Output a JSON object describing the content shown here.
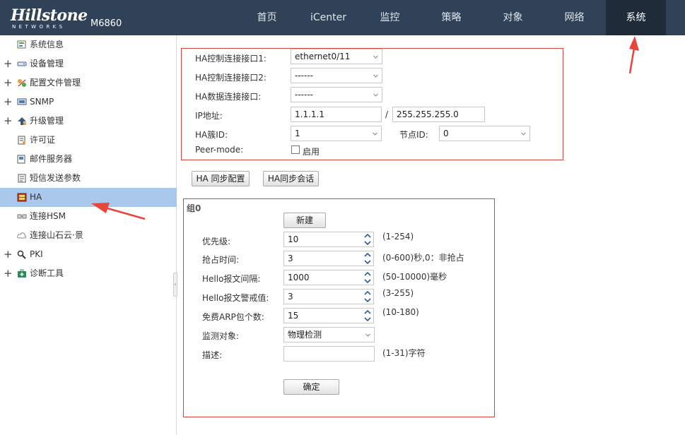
{
  "header": {
    "brand": "Hillstone",
    "brand_sub": "NETWORKS",
    "model": "M6860",
    "nav": [
      {
        "label": "首页",
        "name": "nav-home"
      },
      {
        "label": "iCenter",
        "name": "nav-icenter"
      },
      {
        "label": "监控",
        "name": "nav-monitor"
      },
      {
        "label": "策略",
        "name": "nav-policy"
      },
      {
        "label": "对象",
        "name": "nav-object"
      },
      {
        "label": "网络",
        "name": "nav-network"
      },
      {
        "label": "系统",
        "name": "nav-system"
      }
    ],
    "active_nav": "系统"
  },
  "sidebar": {
    "items": [
      {
        "label": "系统信息",
        "expandable": false,
        "icon": "system-info-icon"
      },
      {
        "label": "设备管理",
        "expandable": true,
        "icon": "device-icon"
      },
      {
        "label": "配置文件管理",
        "expandable": true,
        "icon": "config-file-icon"
      },
      {
        "label": "SNMP",
        "expandable": true,
        "icon": "snmp-icon"
      },
      {
        "label": "升级管理",
        "expandable": true,
        "icon": "upgrade-icon"
      },
      {
        "label": "许可证",
        "expandable": false,
        "icon": "license-icon"
      },
      {
        "label": "邮件服务器",
        "expandable": false,
        "icon": "mail-icon"
      },
      {
        "label": "短信发送参数",
        "expandable": false,
        "icon": "sms-icon"
      },
      {
        "label": "HA",
        "expandable": false,
        "icon": "ha-icon",
        "active": true
      },
      {
        "label": "连接HSM",
        "expandable": false,
        "icon": "hsm-icon"
      },
      {
        "label": "连接山石云·景",
        "expandable": false,
        "icon": "cloud-icon"
      },
      {
        "label": "PKI",
        "expandable": true,
        "icon": "pki-icon"
      },
      {
        "label": "诊断工具",
        "expandable": true,
        "icon": "diagnostic-icon"
      }
    ]
  },
  "ha_link": {
    "ctrl_if1_label": "HA控制连接接口1:",
    "ctrl_if1_value": "ethernet0/11",
    "ctrl_if2_label": "HA控制连接接口2:",
    "ctrl_if2_value": "------",
    "data_if_label": "HA数据连接接口:",
    "data_if_value": "------",
    "ip_label": "IP地址:",
    "ip_value": "1.1.1.1",
    "ip_sep": "/",
    "mask_value": "255.255.255.0",
    "cluster_label": "HA簇ID:",
    "cluster_value": "1",
    "node_label": "节点ID:",
    "node_value": "0",
    "peer_label": "Peer-mode:",
    "peer_check_label": "启用"
  },
  "sync": {
    "config_button": "HA 同步配置",
    "session_button": "HA同步会话"
  },
  "group": {
    "title": "组0",
    "new_button": "新建",
    "priority_label": "优先级:",
    "priority_value": "10",
    "priority_hint": "(1-254)",
    "preempt_label": "抢占时间:",
    "preempt_value": "3",
    "preempt_hint": "(0-600)秒,0：非抢占",
    "hello_int_label": "Hello报文间隔:",
    "hello_int_value": "1000",
    "hello_int_hint": "(50-10000)毫秒",
    "hello_thr_label": "Hello报文警戒值:",
    "hello_thr_value": "3",
    "hello_thr_hint": "(3-255)",
    "arp_label": "免费ARP包个数:",
    "arp_value": "15",
    "arp_hint": "(10-180)",
    "monitor_label": "监测对象:",
    "monitor_value": "物理检测",
    "desc_label": "描述:",
    "desc_value": "",
    "desc_hint": "(1-31)字符",
    "ok_button": "确定"
  },
  "colors": {
    "header_bg": "#304257",
    "active_nav_bg": "#1f2b39",
    "sidebar_active_bg": "#a9c8ec",
    "highlight_red": "#d9443f",
    "arrow_red": "#e8453c"
  }
}
